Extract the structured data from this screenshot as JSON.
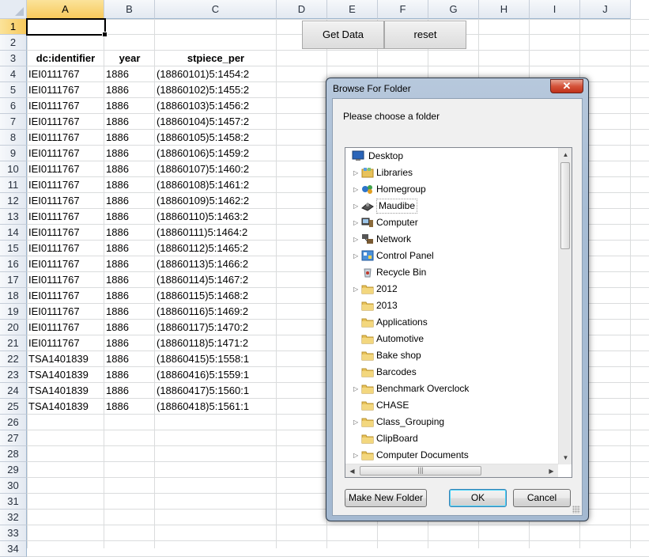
{
  "sheet": {
    "columns": [
      "A",
      "B",
      "C",
      "D",
      "E",
      "F",
      "G",
      "H",
      "I",
      "J"
    ],
    "rows": [
      "1",
      "2",
      "3",
      "4",
      "5",
      "6",
      "7",
      "8",
      "9",
      "10",
      "11",
      "12",
      "13",
      "14",
      "15",
      "16",
      "17",
      "18",
      "19",
      "20",
      "21",
      "22",
      "23",
      "24",
      "25",
      "26",
      "27",
      "28",
      "29",
      "30",
      "31",
      "32",
      "33",
      "34"
    ],
    "headers": {
      "identifier": "dc:identifier",
      "year": "year",
      "stpiece": "stpiece_per"
    },
    "data": [
      [
        "IEI0111767",
        "1886",
        "(18860101)5:1454:2"
      ],
      [
        "IEI0111767",
        "1886",
        "(18860102)5:1455:2"
      ],
      [
        "IEI0111767",
        "1886",
        "(18860103)5:1456:2"
      ],
      [
        "IEI0111767",
        "1886",
        "(18860104)5:1457:2"
      ],
      [
        "IEI0111767",
        "1886",
        "(18860105)5:1458:2"
      ],
      [
        "IEI0111767",
        "1886",
        "(18860106)5:1459:2"
      ],
      [
        "IEI0111767",
        "1886",
        "(18860107)5:1460:2"
      ],
      [
        "IEI0111767",
        "1886",
        "(18860108)5:1461:2"
      ],
      [
        "IEI0111767",
        "1886",
        "(18860109)5:1462:2"
      ],
      [
        "IEI0111767",
        "1886",
        "(18860110)5:1463:2"
      ],
      [
        "IEI0111767",
        "1886",
        "(18860111)5:1464:2"
      ],
      [
        "IEI0111767",
        "1886",
        "(18860112)5:1465:2"
      ],
      [
        "IEI0111767",
        "1886",
        "(18860113)5:1466:2"
      ],
      [
        "IEI0111767",
        "1886",
        "(18860114)5:1467:2"
      ],
      [
        "IEI0111767",
        "1886",
        "(18860115)5:1468:2"
      ],
      [
        "IEI0111767",
        "1886",
        "(18860116)5:1469:2"
      ],
      [
        "IEI0111767",
        "1886",
        "(18860117)5:1470:2"
      ],
      [
        "IEI0111767",
        "1886",
        "(18860118)5:1471:2"
      ],
      [
        "TSA1401839",
        "1886",
        "(18860415)5:1558:1"
      ],
      [
        "TSA1401839",
        "1886",
        "(18860416)5:1559:1"
      ],
      [
        "TSA1401839",
        "1886",
        "(18860417)5:1560:1"
      ],
      [
        "TSA1401839",
        "1886",
        "(18860418)5:1561:1"
      ]
    ],
    "buttons": {
      "get_data": "Get Data",
      "reset": "reset"
    }
  },
  "dialog": {
    "title": "Browse For Folder",
    "close": "✕",
    "prompt": "Please choose a folder",
    "tree": [
      {
        "label": "Desktop",
        "icon": "desktop-icon",
        "expander": false
      },
      {
        "label": "Libraries",
        "icon": "libraries-icon",
        "expander": true
      },
      {
        "label": "Homegroup",
        "icon": "homegroup-icon",
        "expander": true
      },
      {
        "label": "Maudibe",
        "icon": "user-folder-icon",
        "expander": true
      },
      {
        "label": "Computer",
        "icon": "computer-icon",
        "expander": true
      },
      {
        "label": "Network",
        "icon": "network-icon",
        "expander": true
      },
      {
        "label": "Control Panel",
        "icon": "control-panel-icon",
        "expander": true
      },
      {
        "label": "Recycle Bin",
        "icon": "recycle-bin-icon",
        "expander": false
      },
      {
        "label": "2012",
        "icon": "folder-icon",
        "expander": true
      },
      {
        "label": "2013",
        "icon": "folder-icon",
        "expander": false
      },
      {
        "label": "Applications",
        "icon": "folder-icon",
        "expander": false
      },
      {
        "label": "Automotive",
        "icon": "folder-icon",
        "expander": false
      },
      {
        "label": "Bake shop",
        "icon": "folder-icon",
        "expander": false
      },
      {
        "label": "Barcodes",
        "icon": "folder-icon",
        "expander": false
      },
      {
        "label": "Benchmark Overclock",
        "icon": "folder-icon",
        "expander": true
      },
      {
        "label": "CHASE",
        "icon": "folder-icon",
        "expander": false
      },
      {
        "label": "Class_Grouping",
        "icon": "folder-icon",
        "expander": true
      },
      {
        "label": "ClipBoard",
        "icon": "folder-icon",
        "expander": false
      },
      {
        "label": "Computer Documents",
        "icon": "folder-icon",
        "expander": true
      }
    ],
    "buttons": {
      "new_folder": "Make New Folder",
      "ok": "OK",
      "cancel": "Cancel"
    }
  },
  "colors": {
    "selected_header": "#f7c95c",
    "dialog_frame": "#a7bdd5",
    "folder": "#e8c25a"
  }
}
